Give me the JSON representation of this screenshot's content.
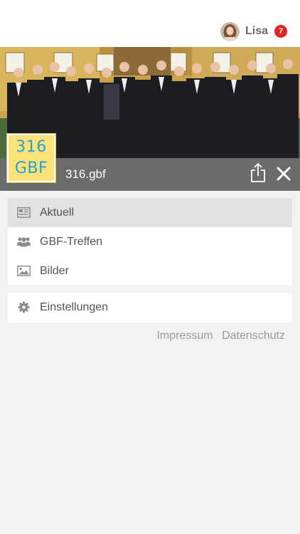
{
  "user": {
    "name": "Lisa",
    "notification_count": "7"
  },
  "group": {
    "title": "316.gbf",
    "logo_line1": "316",
    "logo_line2": "GBF"
  },
  "menu": [
    {
      "label": "Aktuell",
      "icon": "newspaper-icon",
      "active": true
    },
    {
      "label": "GBF-Treffen",
      "icon": "users-icon",
      "active": false
    },
    {
      "label": "Bilder",
      "icon": "image-icon",
      "active": false
    }
  ],
  "settings": {
    "label": "Einstellungen",
    "icon": "gear-icon"
  },
  "footer": {
    "impressum": "Impressum",
    "datenschutz": "Datenschutz"
  },
  "colors": {
    "title_bar": "#6b6b6b",
    "badge": "#e02424",
    "logo_bg": "#fbe37a",
    "logo_text": "#2a9fd0",
    "active_item": "#e2e2e2"
  }
}
